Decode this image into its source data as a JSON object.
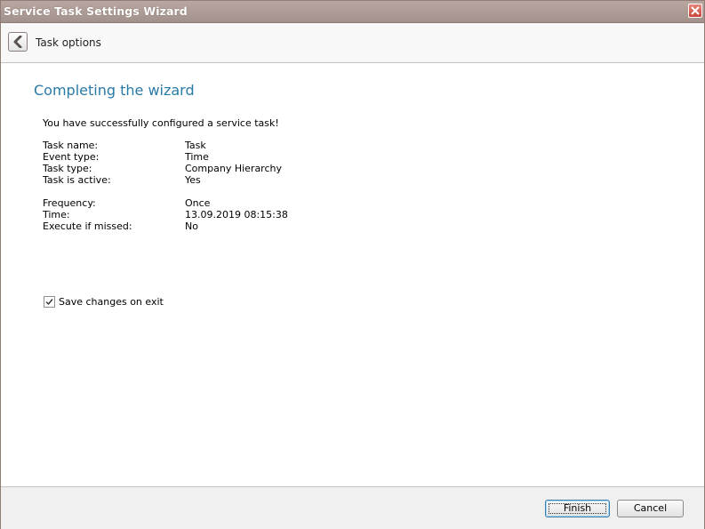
{
  "window": {
    "title": "Service Task Settings Wizard"
  },
  "nav": {
    "back_label": "Task options"
  },
  "main": {
    "heading": "Completing the wizard",
    "intro": "You have successfully configured a service task!",
    "summary": [
      {
        "key": "Task name:",
        "value": "Task"
      },
      {
        "key": "Event type:",
        "value": "Time"
      },
      {
        "key": "Task type:",
        "value": "Company Hierarchy"
      },
      {
        "key": "Task is active:",
        "value": "Yes"
      },
      {
        "key": "Frequency:",
        "value": "Once"
      },
      {
        "key": "Time:",
        "value": "13.09.2019 08:15:38"
      },
      {
        "key": "Execute if missed:",
        "value": "No"
      }
    ],
    "save_changes": {
      "label": "Save changes on exit",
      "checked": true
    }
  },
  "footer": {
    "finish_label": "Finish",
    "cancel_label": "Cancel"
  },
  "colors": {
    "heading": "#2a7aa6",
    "titlebar": "#a3918b"
  }
}
